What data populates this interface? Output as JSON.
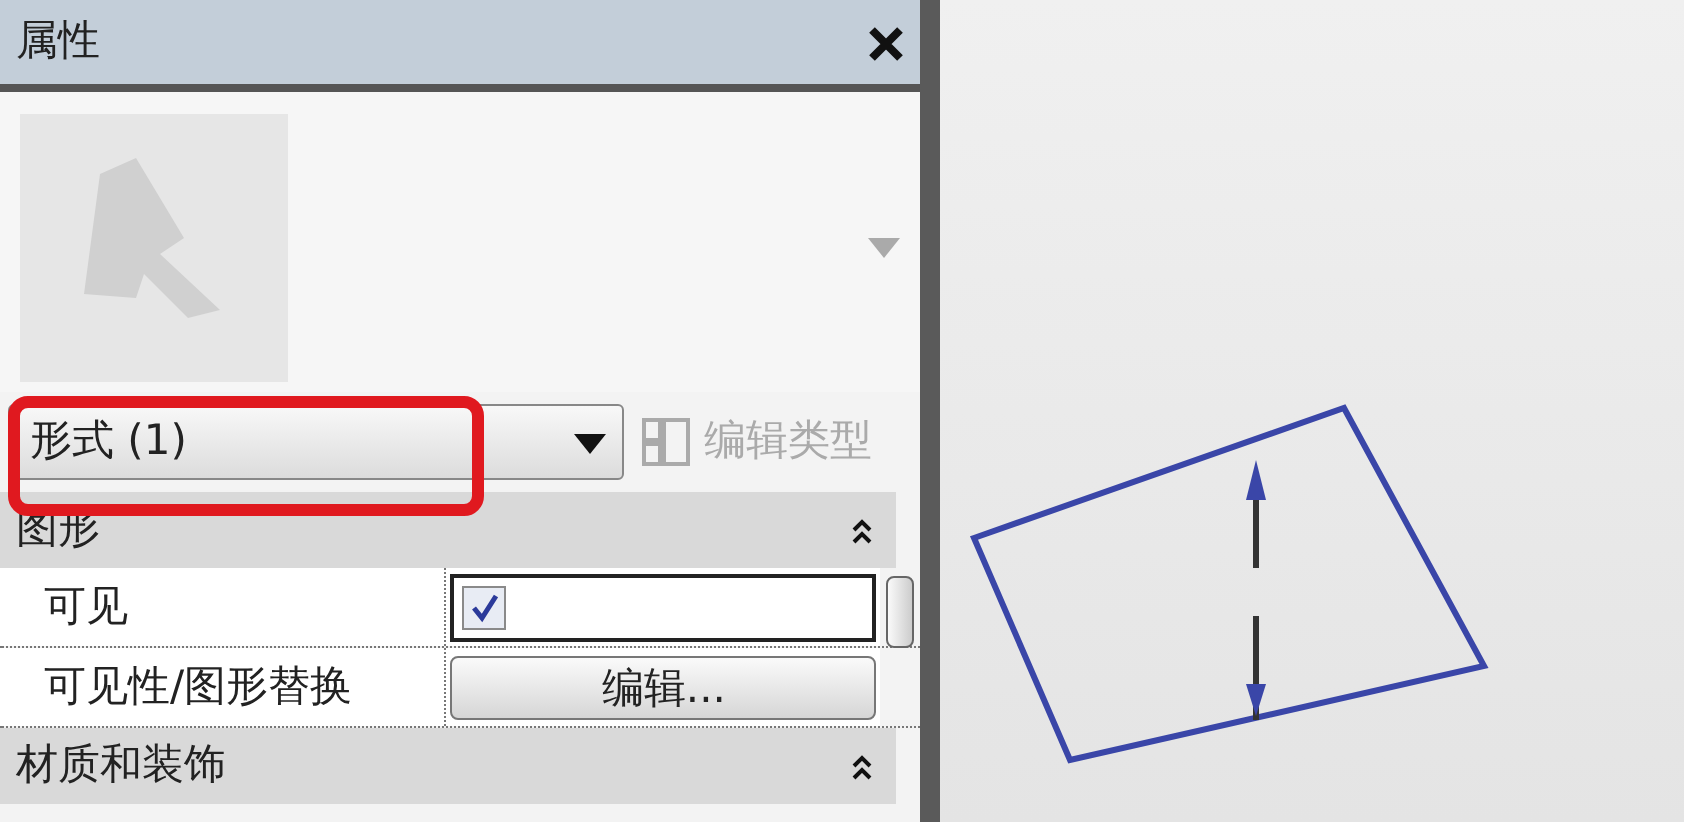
{
  "panel": {
    "title": "属性"
  },
  "type_selector": {
    "value": "形式 (1)",
    "highlighted": true
  },
  "edit_type_button": {
    "label": "编辑类型",
    "disabled": true
  },
  "groups": [
    {
      "label": "图形",
      "expanded": true,
      "properties": [
        {
          "kind": "checkbox",
          "label": "可见",
          "checked": true
        },
        {
          "kind": "button",
          "label": "可见性/图形替换",
          "value": "编辑..."
        }
      ]
    },
    {
      "label": "材质和装饰",
      "expanded": true
    }
  ]
}
